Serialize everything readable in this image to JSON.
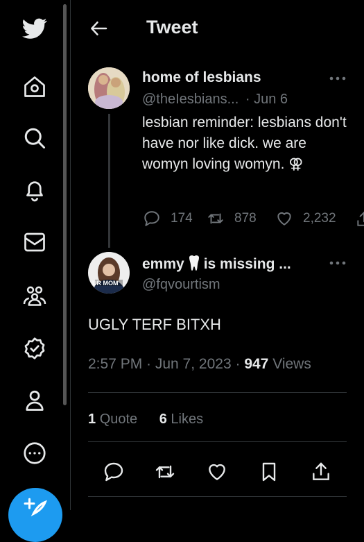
{
  "sidebar": {
    "icons": [
      "twitter-bird-icon",
      "home-icon",
      "search-icon",
      "bell-icon",
      "mail-icon",
      "communities-icon",
      "verified-icon",
      "profile-icon",
      "more-circle-icon",
      "compose-icon"
    ]
  },
  "header": {
    "title": "Tweet"
  },
  "parent_tweet": {
    "name": "home of lesbians",
    "handle": "@theIesbians...",
    "separator": "·",
    "date": "Jun 6",
    "text": "lesbian reminder: lesbians don't have nor like dick. we are womyn loving womyn. ⚢",
    "replies": "174",
    "retweets": "878",
    "likes": "2,232"
  },
  "reply_tweet": {
    "name": "emmy🦷 is missing ...",
    "name_part": "emmy",
    "name_suffix": "is missing ...",
    "avatar_label": "UR MOM",
    "handle": "@fqvourtism",
    "text": "UGLY TERF BITXH",
    "time": "2:57 PM · Jun 7, 2023 ·",
    "views_count": "947",
    "views_label": "Views",
    "quotes_count": "1",
    "quotes_label": "Quote",
    "likes_count": "6",
    "likes_label": "Likes"
  },
  "colors": {
    "accent": "#1d9bf0",
    "background": "#000000",
    "text": "#e7e9ea",
    "muted": "#71767b"
  }
}
